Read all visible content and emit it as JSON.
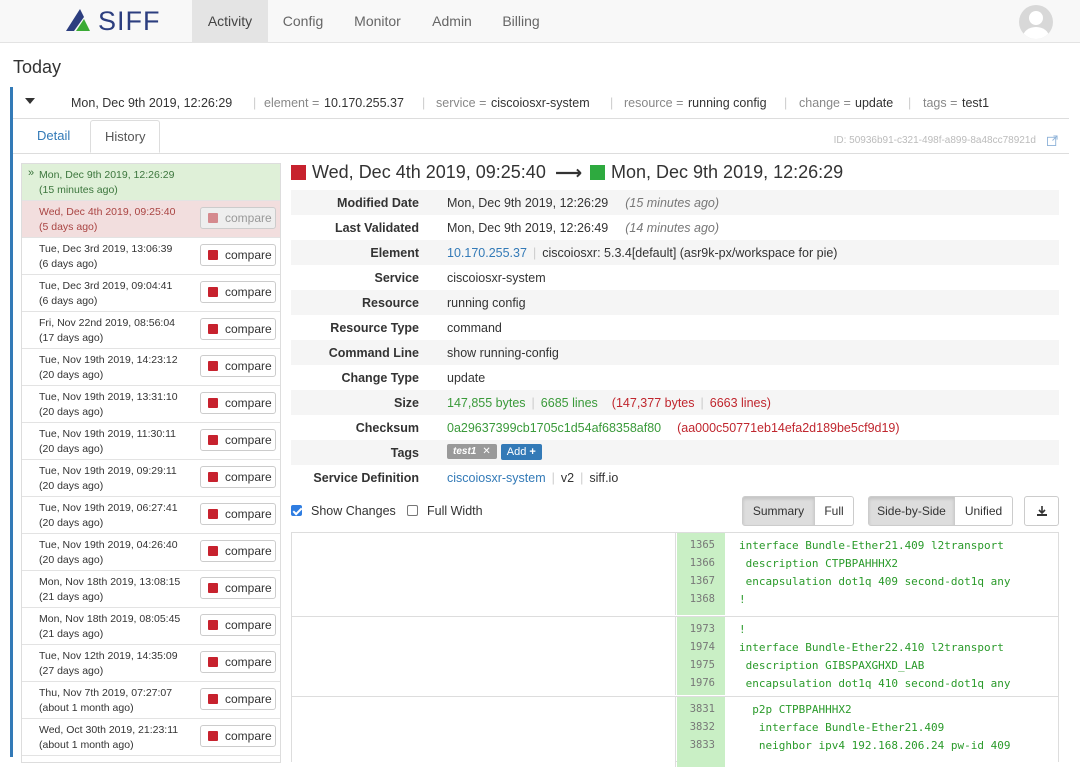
{
  "app": {
    "logo_text": "SIFF"
  },
  "nav": {
    "items": [
      "Activity",
      "Config",
      "Monitor",
      "Admin",
      "Billing"
    ],
    "active": "Activity"
  },
  "page": {
    "title": "Today"
  },
  "summary": {
    "timestamp": "Mon, Dec 9th 2019, 12:26:29",
    "element_key": "element =",
    "element_val": "10.170.255.37",
    "service_key": "service =",
    "service_val": "ciscoiosxr-system",
    "resource_key": "resource =",
    "resource_val": "running config",
    "change_key": "change =",
    "change_val": "update",
    "tags_key": "tags =",
    "tags_val": "test1"
  },
  "tabs": {
    "detail": "Detail",
    "history": "History"
  },
  "record_id": "ID: 50936b91-c321-498f-a899-8a48cc78921d",
  "history": {
    "compare_label": "compare",
    "rows": [
      {
        "date": "Mon, Dec 9th 2019, 12:26:29",
        "ago": "(15 minutes ago)",
        "state": "current"
      },
      {
        "date": "Wed, Dec 4th 2019, 09:25:40",
        "ago": "(5 days ago)",
        "state": "base"
      },
      {
        "date": "Tue, Dec 3rd 2019, 13:06:39",
        "ago": "(6 days ago)",
        "state": "normal"
      },
      {
        "date": "Tue, Dec 3rd 2019, 09:04:41",
        "ago": "(6 days ago)",
        "state": "normal"
      },
      {
        "date": "Fri, Nov 22nd 2019, 08:56:04",
        "ago": "(17 days ago)",
        "state": "normal"
      },
      {
        "date": "Tue, Nov 19th 2019, 14:23:12",
        "ago": "(20 days ago)",
        "state": "normal"
      },
      {
        "date": "Tue, Nov 19th 2019, 13:31:10",
        "ago": "(20 days ago)",
        "state": "normal"
      },
      {
        "date": "Tue, Nov 19th 2019, 11:30:11",
        "ago": "(20 days ago)",
        "state": "normal"
      },
      {
        "date": "Tue, Nov 19th 2019, 09:29:11",
        "ago": "(20 days ago)",
        "state": "normal"
      },
      {
        "date": "Tue, Nov 19th 2019, 06:27:41",
        "ago": "(20 days ago)",
        "state": "normal"
      },
      {
        "date": "Tue, Nov 19th 2019, 04:26:40",
        "ago": "(20 days ago)",
        "state": "normal"
      },
      {
        "date": "Mon, Nov 18th 2019, 13:08:15",
        "ago": "(21 days ago)",
        "state": "normal"
      },
      {
        "date": "Mon, Nov 18th 2019, 08:05:45",
        "ago": "(21 days ago)",
        "state": "normal"
      },
      {
        "date": "Tue, Nov 12th 2019, 14:35:09",
        "ago": "(27 days ago)",
        "state": "normal"
      },
      {
        "date": "Thu, Nov 7th 2019, 07:27:07",
        "ago": "(about 1 month ago)",
        "state": "normal"
      },
      {
        "date": "Wed, Oct 30th 2019, 21:23:11",
        "ago": "(about 1 month ago)",
        "state": "normal"
      }
    ]
  },
  "compare_header": {
    "from": "Wed, Dec 4th 2019, 09:25:40",
    "to": "Mon, Dec 9th 2019, 12:26:29",
    "from_color": "#c7222e",
    "to_color": "#2eaa3f"
  },
  "details": {
    "modified_date": {
      "label": "Modified Date",
      "value": "Mon, Dec 9th 2019, 12:26:29",
      "ago": "(15 minutes ago)"
    },
    "last_validated": {
      "label": "Last Validated",
      "value": "Mon, Dec 9th 2019, 12:26:49",
      "ago": "(14 minutes ago)"
    },
    "element": {
      "label": "Element",
      "ip": "10.170.255.37",
      "desc": "ciscoiosxr: 5.3.4[default] (asr9k-px/workspace for pie)"
    },
    "service": {
      "label": "Service",
      "value": "ciscoiosxr-system"
    },
    "resource": {
      "label": "Resource",
      "value": "running config"
    },
    "resource_type": {
      "label": "Resource Type",
      "value": "command"
    },
    "command_line": {
      "label": "Command Line",
      "value": "show running-config"
    },
    "change_type": {
      "label": "Change Type",
      "value": "update"
    },
    "size": {
      "label": "Size",
      "bytes": "147,855 bytes",
      "lines": "6685 lines",
      "old_bytes": "(147,377 bytes",
      "old_lines": "6663 lines)"
    },
    "checksum": {
      "label": "Checksum",
      "value": "0a29637399cb1705c1d54af68358af80",
      "old": "(aa000c50771eb14efa2d189be5cf9d19)"
    },
    "tags": {
      "label": "Tags",
      "tag": "test1",
      "add": "Add"
    },
    "service_definition": {
      "label": "Service Definition",
      "name": "ciscoiosxr-system",
      "version": "v2",
      "source": "siff.io"
    }
  },
  "controls": {
    "show_changes": {
      "label": "Show Changes",
      "checked": true
    },
    "full_width": {
      "label": "Full Width",
      "checked": false
    },
    "summary": "Summary",
    "full": "Full",
    "side_by_side": "Side-by-Side",
    "unified": "Unified"
  },
  "diff": {
    "blocks": [
      {
        "lines": [
          {
            "n": "1365",
            "t": "interface Bundle-Ether21.409 l2transport"
          },
          {
            "n": "1366",
            "t": " description CTPBPAHHHX2"
          },
          {
            "n": "1367",
            "t": " encapsulation dot1q 409 second-dot1q any"
          },
          {
            "n": "1368",
            "t": "!"
          }
        ]
      },
      {
        "lines": [
          {
            "n": "1973",
            "t": "!"
          },
          {
            "n": "1974",
            "t": "interface Bundle-Ether22.410 l2transport"
          },
          {
            "n": "1975",
            "t": " description GIBSPAXGHXD_LAB"
          },
          {
            "n": "1976",
            "t": " encapsulation dot1q 410 second-dot1q any"
          }
        ]
      },
      {
        "lines": [
          {
            "n": "3831",
            "t": "  p2p CTPBPAHHHX2"
          },
          {
            "n": "3832",
            "t": "   interface Bundle-Ether21.409"
          },
          {
            "n": "3833",
            "t": "   neighbor ipv4 192.168.206.24 pw-id 409"
          }
        ]
      }
    ]
  }
}
